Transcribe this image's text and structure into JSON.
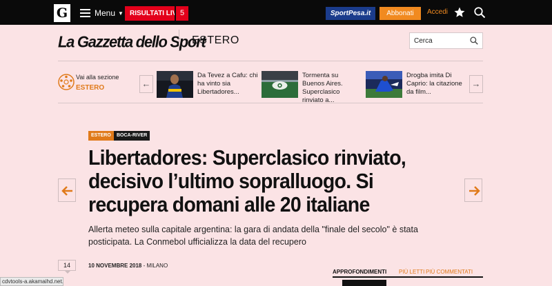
{
  "topbar": {
    "logo_letter": "G",
    "menu_label": "Menu",
    "live_label": "RISULTATI LIVE",
    "live_count": "5",
    "sportpesa_label": "SportPesa.it",
    "abbonati_label": "Abbonati",
    "accedi_label": "Accedi",
    "icons": [
      "star-icon",
      "search-icon"
    ]
  },
  "brand": {
    "name": "La Gazzetta dello Sport",
    "section": "ESTERO"
  },
  "search": {
    "placeholder": "Cerca"
  },
  "related": {
    "goto_label": "Vai alla sezione",
    "goto_section": "ESTERO",
    "items": [
      {
        "line1": "Da Tevez a Cafu: chi",
        "line2": "ha vinto sia",
        "line3": "Libertadores..."
      },
      {
        "line1": "Tormenta su",
        "line2": "Buenos Aires.",
        "line3": "Superclasico",
        "line4": "rinviato a..."
      },
      {
        "line1": "Drogba imita Di",
        "line2": "Caprio: la citazione",
        "line3": "da film..."
      }
    ]
  },
  "article": {
    "tags": [
      "ESTERO",
      "BOCA-RIVER"
    ],
    "headline_lines": [
      "Libertadores: Superclasico rinviato,",
      "decisivo l’ultimo sopralluogo. Si",
      "recupera domani alle 20 italiane"
    ],
    "subhead_lines": [
      "Allerta meteo sulla capitale argentina: la gara di andata della \"finale del secolo\" è stata",
      "posticipata. La Conmebol ufficializza la data del recupero"
    ],
    "comments": "14",
    "date": "10 NOVEMBRE 2018",
    "place": "- MILANO"
  },
  "tabs": [
    "APPROFONDIMENTI",
    "PIÙ LETTI",
    "PIÙ COMMENTATI"
  ],
  "status_text": "cdvtools-a.akamaihd.net...",
  "colors": {
    "background": "#fbe3e5",
    "accent": "#e07a1a",
    "live_red": "#e3001b",
    "sportpesa_blue": "#1b3c8c"
  }
}
